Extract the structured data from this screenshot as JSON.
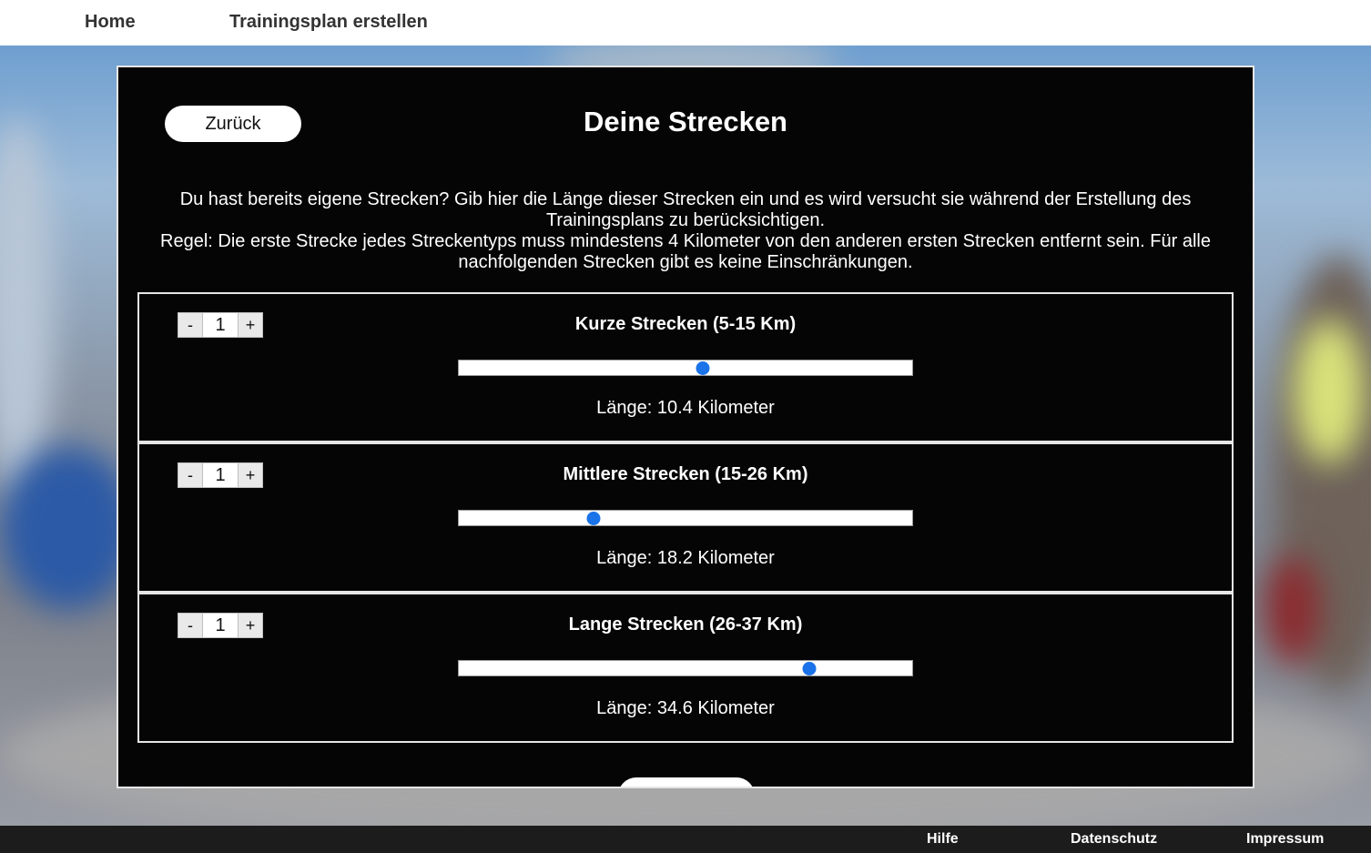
{
  "nav": {
    "home": "Home",
    "create_plan": "Trainingsplan erstellen"
  },
  "panel": {
    "back_label": "Zurück",
    "title": "Deine Strecken",
    "intro_line1": "Du hast bereits eigene Strecken? Gib hier die Länge dieser Strecken ein und es wird versucht sie während der Erstellung des Trainingsplans zu berücksichtigen.",
    "intro_line2": "Regel: Die erste Strecke jedes Streckentyps muss mindestens 4 Kilometer von den anderen ersten Strecken entfernt sein. Für alle nachfolgenden Strecken gibt es keine Einschränkungen."
  },
  "routes": [
    {
      "minus": "-",
      "count": "1",
      "plus": "+",
      "title": "Kurze Strecken (5-15 Km)",
      "min": 5,
      "max": 15,
      "value": 10.4,
      "length_label": "Länge: 10.4 Kilometer"
    },
    {
      "minus": "-",
      "count": "1",
      "plus": "+",
      "title": "Mittlere Strecken (15-26 Km)",
      "min": 15,
      "max": 26,
      "value": 18.2,
      "length_label": "Länge: 18.2 Kilometer"
    },
    {
      "minus": "-",
      "count": "1",
      "plus": "+",
      "title": "Lange Strecken (26-37 Km)",
      "min": 26,
      "max": 37,
      "value": 34.6,
      "length_label": "Länge: 34.6 Kilometer"
    }
  ],
  "footer": {
    "help": "Hilfe",
    "privacy": "Datenschutz",
    "imprint": "Impressum"
  },
  "colors": {
    "slider_thumb": "#1a73e8",
    "panel_bg": "#050505",
    "footer_bg": "#1c1c1c"
  }
}
